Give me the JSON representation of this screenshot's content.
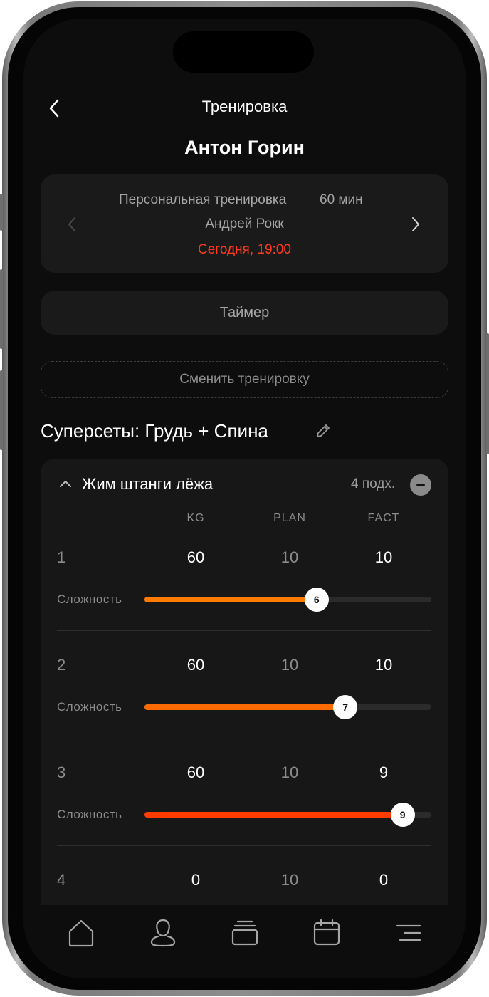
{
  "header": {
    "title": "Тренировка",
    "client_name": "Антон Горин"
  },
  "session": {
    "type": "Персональная тренировка",
    "duration": "60 мин",
    "trainer": "Андрей Рокк",
    "time": "Сегодня, 19:00"
  },
  "timer_label": "Таймер",
  "change_workout_label": "Сменить тренировку",
  "workout_title": "Суперсеты: Грудь + Спина",
  "exercise": {
    "name": "Жим штанги лёжа",
    "sets_count": "4 подх.",
    "columns": [
      "KG",
      "PLAN",
      "FACT"
    ],
    "difficulty_label": "Сложность",
    "sets": [
      {
        "num": "1",
        "kg": "60",
        "plan": "10",
        "fact": "10",
        "difficulty": "6",
        "level": 0.6,
        "color": "#ff7a00"
      },
      {
        "num": "2",
        "kg": "60",
        "plan": "10",
        "fact": "10",
        "difficulty": "7",
        "level": 0.7,
        "color": "#ff6a00"
      },
      {
        "num": "3",
        "kg": "60",
        "plan": "10",
        "fact": "9",
        "difficulty": "9",
        "level": 0.9,
        "color": "#ff3b00"
      },
      {
        "num": "4",
        "kg": "0",
        "plan": "10",
        "fact": "0"
      }
    ]
  },
  "colors": {
    "accent_red": "#ff3b1f",
    "accent_orange": "#ff7a00",
    "background": "#0d0d0d",
    "card": "#1a1a1a"
  },
  "tabbar": {
    "icons": [
      "home-icon",
      "profile-icon",
      "workouts-icon",
      "calendar-icon",
      "menu-icon"
    ]
  }
}
